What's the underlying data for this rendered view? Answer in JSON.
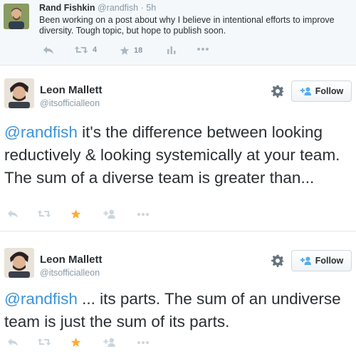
{
  "quoted_tweet": {
    "name": "Rand Fishkin",
    "handle": "@randfish",
    "separator": "·",
    "time": "5h",
    "text": "Been working on a post about why I believe in intentional efforts to improve diversity. Tough topic, but hope to publish soon.",
    "retweet_count": "4",
    "favorite_count": "18"
  },
  "tweets": [
    {
      "name": "Leon Mallett",
      "handle": "@itsofficialleon",
      "follow_label": "Follow",
      "mention": "@randfish",
      "text": " it's the difference between looking reductively & looking systemically at your team. The sum of a diverse team is greater than..."
    },
    {
      "name": "Leon Mallett",
      "handle": "@itsofficialleon",
      "follow_label": "Follow",
      "mention": "@randfish",
      "text": " ... its parts. The sum of an undiverse team is just the sum of its parts."
    }
  ],
  "colors": {
    "link": "#3b94d9",
    "icon_gray": "#aab8c2",
    "favorite_active": "#ffac33",
    "follow_icon": "#55acee"
  },
  "icons": [
    "reply-icon",
    "retweet-icon",
    "favorite-icon",
    "analytics-icon",
    "more-icon",
    "follow-icon",
    "gear-icon"
  ]
}
